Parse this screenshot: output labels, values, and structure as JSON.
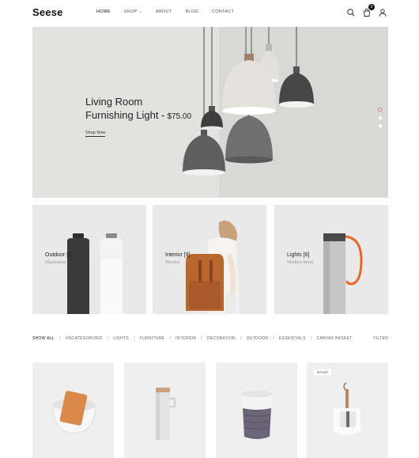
{
  "brand": {
    "logo": "Seese"
  },
  "nav": [
    {
      "label": "HOME"
    },
    {
      "label": "SHOP"
    },
    {
      "label": "ABOUT"
    },
    {
      "label": "BLOG"
    },
    {
      "label": "CONTACT"
    }
  ],
  "header": {
    "cart_count": "0",
    "icons": [
      "search-icon",
      "cart-icon",
      "user-icon"
    ]
  },
  "hero": {
    "title_line1": "Living Room",
    "title_line2": "Furnishing Light -",
    "price": "$75.00",
    "cta": "Shop Now",
    "slide_count": 3,
    "active_slide": 1
  },
  "categories": [
    {
      "name": "Outdoor [8]",
      "subtitle": "Illustration"
    },
    {
      "name": "Interior [9]",
      "subtitle": "Internal"
    },
    {
      "name": "Lights [6]",
      "subtitle": "Modern Items"
    }
  ],
  "filters": {
    "items": [
      "SHOW ALL",
      "UNCATEGORIZED",
      "LIGHTS",
      "FURNITURE",
      "INTERIOR",
      "DECORATION",
      "OUTDOOR",
      "ESSENTIALS",
      "CANVAS BASKET"
    ],
    "filter_label": "FILTER"
  },
  "products": [
    {
      "badge": ""
    },
    {
      "badge": ""
    },
    {
      "badge": ""
    },
    {
      "badge": "SALE!"
    }
  ],
  "colors": {
    "accent": "#e96e5c",
    "orange": "#e8672a",
    "hero_bg": "#e2e2e1",
    "card_bg": "#e9e9e9"
  }
}
